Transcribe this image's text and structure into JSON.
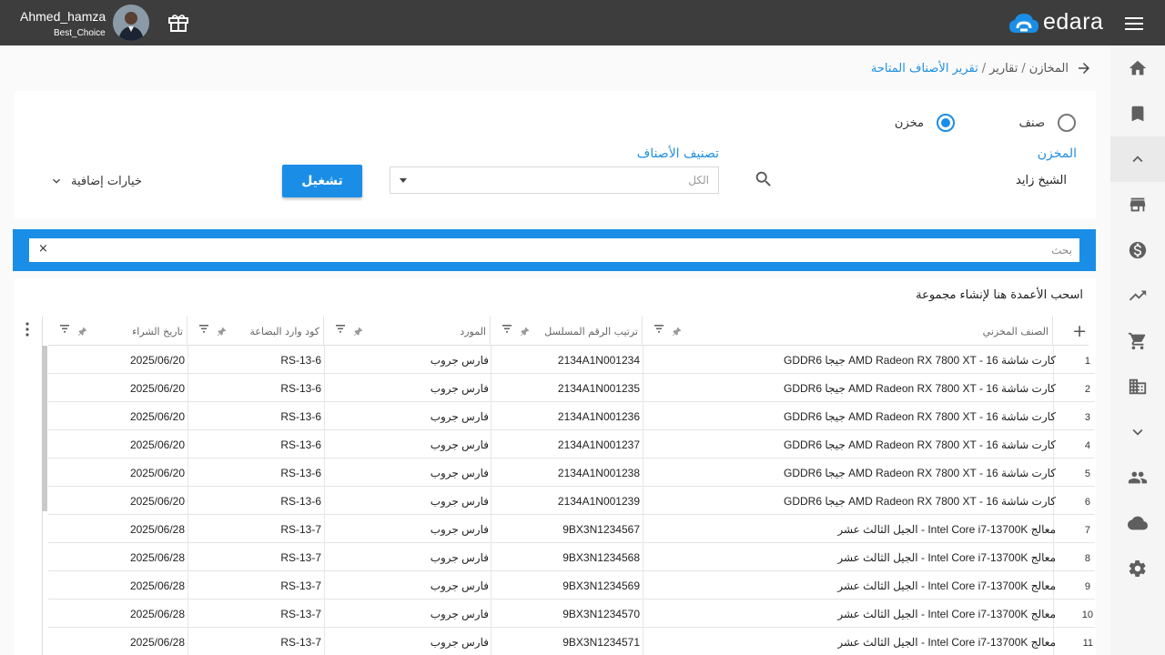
{
  "topbar": {
    "user_name": "Ahmed_hamza",
    "user_role": "Best_Choice",
    "logo_text": "edara",
    "icons": [
      "gift-icon",
      "menu-icon",
      "cloud-logo-icon"
    ]
  },
  "breadcrumb": {
    "items": [
      "المخازن",
      "تقارير"
    ],
    "current": "تقرير الأصناف المتاحة"
  },
  "filters": {
    "radio_item_label": "صنف",
    "radio_store_label": "مخزن",
    "store_label": "المخزن",
    "store_value": "الشيخ زايد",
    "category_label": "تصنيف الأصناف",
    "category_value": "الكل",
    "run_label": "تشغيل",
    "extra_options_label": "خيارات إضافية"
  },
  "search": {
    "placeholder": "بحث",
    "clear": "×"
  },
  "grid": {
    "group_hint": "اسحب الأعمدة هنا لإنشاء مجموعة",
    "add_symbol": "+",
    "columns": [
      "الصنف المخزني",
      "ترتيب الرقم المسلسل",
      "المورد",
      "كود وارد البضاعة",
      "تاريخ الشراء"
    ],
    "rows": [
      {
        "n": "1",
        "item": "كارت شاشة AMD Radeon RX 7800 XT - 16 جيجا GDDR6",
        "serial": "2134A1N001234",
        "supplier": "فارس جروب",
        "code": "RS-13-6",
        "date": "2025/06/20"
      },
      {
        "n": "2",
        "item": "كارت شاشة AMD Radeon RX 7800 XT - 16 جيجا GDDR6",
        "serial": "2134A1N001235",
        "supplier": "فارس جروب",
        "code": "RS-13-6",
        "date": "2025/06/20"
      },
      {
        "n": "3",
        "item": "كارت شاشة AMD Radeon RX 7800 XT - 16 جيجا GDDR6",
        "serial": "2134A1N001236",
        "supplier": "فارس جروب",
        "code": "RS-13-6",
        "date": "2025/06/20"
      },
      {
        "n": "4",
        "item": "كارت شاشة AMD Radeon RX 7800 XT - 16 جيجا GDDR6",
        "serial": "2134A1N001237",
        "supplier": "فارس جروب",
        "code": "RS-13-6",
        "date": "2025/06/20"
      },
      {
        "n": "5",
        "item": "كارت شاشة AMD Radeon RX 7800 XT - 16 جيجا GDDR6",
        "serial": "2134A1N001238",
        "supplier": "فارس جروب",
        "code": "RS-13-6",
        "date": "2025/06/20"
      },
      {
        "n": "6",
        "item": "كارت شاشة AMD Radeon RX 7800 XT - 16 جيجا GDDR6",
        "serial": "2134A1N001239",
        "supplier": "فارس جروب",
        "code": "RS-13-6",
        "date": "2025/06/20"
      },
      {
        "n": "7",
        "item": "معالج Intel Core i7-13700K - الجيل الثالث عشر",
        "serial": "9BX3N1234567",
        "supplier": "فارس جروب",
        "code": "RS-13-7",
        "date": "2025/06/28"
      },
      {
        "n": "8",
        "item": "معالج Intel Core i7-13700K - الجيل الثالث عشر",
        "serial": "9BX3N1234568",
        "supplier": "فارس جروب",
        "code": "RS-13-7",
        "date": "2025/06/28"
      },
      {
        "n": "9",
        "item": "معالج Intel Core i7-13700K - الجيل الثالث عشر",
        "serial": "9BX3N1234569",
        "supplier": "فارس جروب",
        "code": "RS-13-7",
        "date": "2025/06/28"
      },
      {
        "n": "10",
        "item": "معالج Intel Core i7-13700K - الجيل الثالث عشر",
        "serial": "9BX3N1234570",
        "supplier": "فارس جروب",
        "code": "RS-13-7",
        "date": "2025/06/28"
      },
      {
        "n": "11",
        "item": "معالج Intel Core i7-13700K - الجيل الثالث عشر",
        "serial": "9BX3N1234571",
        "supplier": "فارس جروب",
        "code": "RS-13-7",
        "date": "2025/06/28"
      }
    ]
  },
  "sidebar": {
    "icons": [
      "home-icon",
      "bookmark-icon",
      "chevron-up-icon",
      "store-icon",
      "dollar-icon",
      "trending-icon",
      "cart-icon",
      "building-icon",
      "chevron-down-icon",
      "people-icon",
      "cloud-icon",
      "settings-icon"
    ]
  },
  "colors": {
    "accent": "#1a8ee6",
    "topbar": "#3d3d3d",
    "link": "#1f8fe0"
  }
}
